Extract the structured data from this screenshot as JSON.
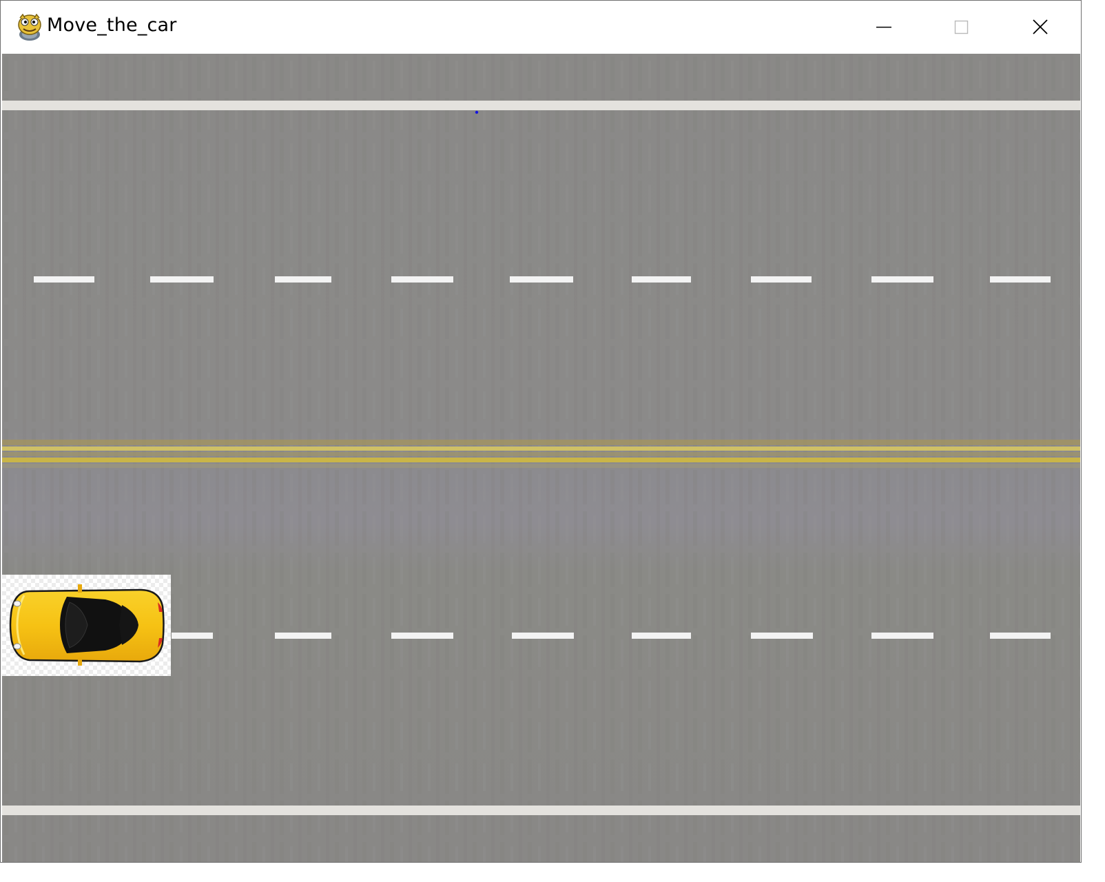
{
  "window": {
    "title": "Move_the_car",
    "icon": "pygame-snake-icon",
    "controls": {
      "minimize": "minimize-icon",
      "maximize": "maximize-icon",
      "close": "close-icon"
    }
  },
  "scene": {
    "road_color": "#8c8b89",
    "edge_line_color": "#e2e0dc",
    "lane_dash_color": "#f2f2f2",
    "center_line_color": "#c9b548",
    "car_color": "#f7c21a",
    "marker_color": "#1414e0"
  }
}
